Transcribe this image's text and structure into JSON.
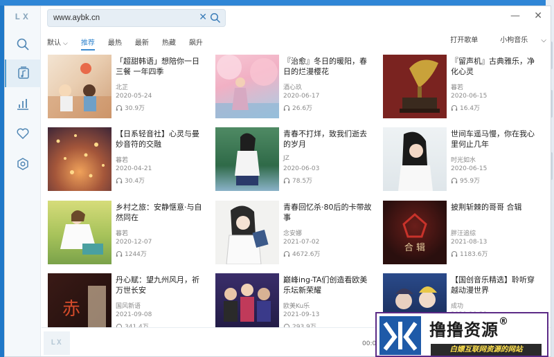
{
  "app": {
    "logo": "LX",
    "player_logo": "LX"
  },
  "search": {
    "value": "www.aybk.cn"
  },
  "window_controls": {
    "minimize": "—",
    "close": "✕"
  },
  "nav": [
    {
      "icon": "search-icon"
    },
    {
      "icon": "music-list-icon",
      "active": true
    },
    {
      "icon": "chart-icon"
    },
    {
      "icon": "heart-icon"
    },
    {
      "icon": "settings-icon"
    }
  ],
  "tabs": {
    "sort": "默认",
    "items": [
      "推荐",
      "最热",
      "最新",
      "热藏",
      "飙升"
    ],
    "active_index": 0,
    "open_playlist": "打开歌单",
    "source": "小枸音乐"
  },
  "playlists": [
    {
      "title": "「超甜韩语」想陪你一日三餐 一年四季",
      "author": "北芷",
      "date": "2020-05-24",
      "plays": "30.9万"
    },
    {
      "title": "『治愈』冬日的暖阳，春日的烂漫樱花",
      "author": "酒心玖",
      "date": "2020-06-17",
      "plays": "26.6万"
    },
    {
      "title": "『留声机』古典雅乐，净化心灵",
      "author": "暮若",
      "date": "2020-06-15",
      "plays": "16.4万"
    },
    {
      "title": "【日系轻音社】心灵与曼妙音符的交融",
      "author": "暮若",
      "date": "2020-04-21",
      "plays": "30.4万"
    },
    {
      "title": "青春不打烊，致我们逝去的岁月",
      "author": "JZ",
      "date": "2020-06-03",
      "plays": "78.5万"
    },
    {
      "title": "世间车遥马慢，你在我心里何止几年",
      "author": "时光如水",
      "date": "2020-06-15",
      "plays": "95.9万"
    },
    {
      "title": "乡村之旅：安静惬意·与自然同在",
      "author": "暮若",
      "date": "2020-12-07",
      "plays": "1244万"
    },
    {
      "title": "青春回忆杀·80后的卡带故事",
      "author": "念安娜",
      "date": "2021-07-02",
      "plays": "4672.6万"
    },
    {
      "title": "披荆斩棘的哥哥 合辑",
      "author": "胖汪追综",
      "date": "2021-08-13",
      "plays": "1183.6万"
    },
    {
      "title": "丹心赋：望九州风月，祈万世长安",
      "author": "国风新语",
      "date": "2021-09-08",
      "plays": "341.4万"
    },
    {
      "title": "巅峰ing-TA们创造看欧美乐坛新荣耀",
      "author": "欧美Ku乐",
      "date": "2021-09-13",
      "plays": "293.9万"
    },
    {
      "title": "【国创音乐精选】聆听穿越动漫世界",
      "author": "成功",
      "date": "2020-10-29",
      "plays": ""
    }
  ],
  "player": {
    "time": "00:0"
  },
  "watermark": {
    "title": "撸撸资源",
    "reg": "®",
    "subtitle": "白嫖互联网资源的网站"
  },
  "colors": {
    "accent": "#3a8ad0",
    "sidebar_bg": "#f4f8fb"
  }
}
